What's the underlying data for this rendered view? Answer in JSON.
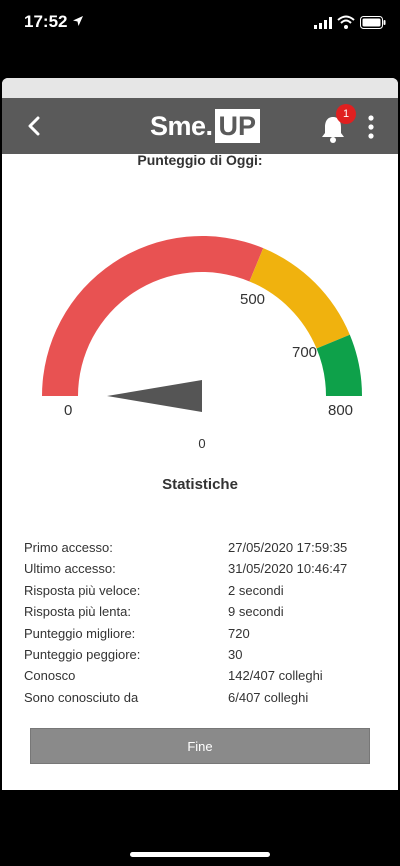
{
  "status_bar": {
    "time": "17:52"
  },
  "header": {
    "logo_text": "Sme.",
    "logo_box": "UP",
    "notification_count": "1"
  },
  "gauge": {
    "title": "Punteggio di Oggi:",
    "min_label": "0",
    "mark_500": "500",
    "mark_700": "700",
    "max_label": "800",
    "value": "0",
    "score": 0,
    "max": 800,
    "colors": {
      "low": "#e85252",
      "mid": "#f0b20e",
      "high": "#0ea14a",
      "needle": "#555555"
    }
  },
  "stats": {
    "title": "Statistiche",
    "rows": [
      {
        "label": "Primo accesso:",
        "value": "27/05/2020 17:59:35"
      },
      {
        "label": "Ultimo accesso:",
        "value": "31/05/2020 10:46:47"
      },
      {
        "label": "Risposta più veloce:",
        "value": "2 secondi"
      },
      {
        "label": "Risposta più lenta:",
        "value": "9 secondi"
      },
      {
        "label": "Punteggio migliore:",
        "value": "720"
      },
      {
        "label": "Punteggio peggiore:",
        "value": "30"
      },
      {
        "label": "Conosco",
        "value": "142/407 colleghi"
      },
      {
        "label": "Sono conosciuto da",
        "value": "6/407 colleghi"
      }
    ]
  },
  "footer": {
    "done_label": "Fine"
  }
}
